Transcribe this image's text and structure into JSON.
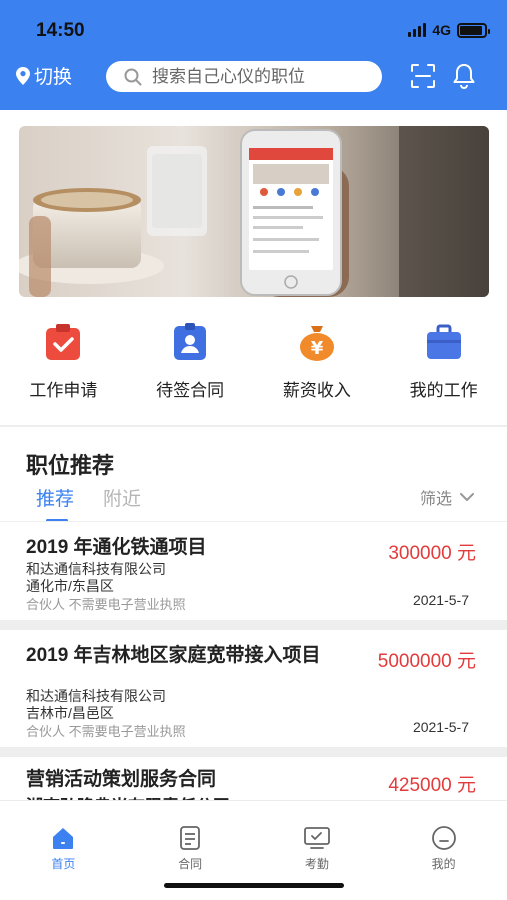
{
  "status": {
    "time": "14:50",
    "network": "4G",
    "battery_level": 0.9
  },
  "header": {
    "location_label": "切换",
    "search_placeholder": "搜索自己心仪的职位",
    "icons": [
      "location-pin-icon",
      "search-icon",
      "scan-icon",
      "bell-icon"
    ]
  },
  "banner": {
    "description_icon": "banner-image"
  },
  "quick_actions": [
    {
      "label": "工作申请",
      "icon": "clipboard-check-icon",
      "color": "#ee4b3f"
    },
    {
      "label": "待签合同",
      "icon": "badge-user-icon",
      "color": "#3f6fe0"
    },
    {
      "label": "薪资收入",
      "icon": "money-bag-icon",
      "color": "#f08a2b"
    },
    {
      "label": "我的工作",
      "icon": "briefcase-icon",
      "color": "#4b76e6"
    }
  ],
  "jobs_section": {
    "title": "职位推荐",
    "tabs": [
      {
        "label": "推荐",
        "active": true
      },
      {
        "label": "附近",
        "active": false
      }
    ],
    "filter_label": "筛选",
    "items": [
      {
        "title": "2019 年通化铁通项目",
        "price": "300000 元",
        "company": "和达通信科技有限公司",
        "location": "通化市/东昌区",
        "tags": "合伙人   不需要电子营业执照",
        "date": "2021-5-7"
      },
      {
        "title": "2019 年吉林地区家庭宽带接入项目",
        "price": "5000000 元",
        "company": "和达通信科技有限公司",
        "location": "吉林市/昌邑区",
        "tags": "合伙人   不需要电子营业执照",
        "date": "2021-5-7"
      },
      {
        "title": "营销活动策划服务合同",
        "price": "425000 元",
        "company": "湖南弘隆典当有限责任公司"
      }
    ]
  },
  "tabbar": {
    "items": [
      {
        "label": "首页",
        "icon": "home-icon",
        "active": true
      },
      {
        "label": "合同",
        "icon": "document-icon",
        "active": false
      },
      {
        "label": "考勤",
        "icon": "attendance-icon",
        "active": false
      },
      {
        "label": "我的",
        "icon": "profile-icon",
        "active": false
      }
    ]
  },
  "colors": {
    "primary": "#3b82f0",
    "price": "#e23b3b"
  }
}
